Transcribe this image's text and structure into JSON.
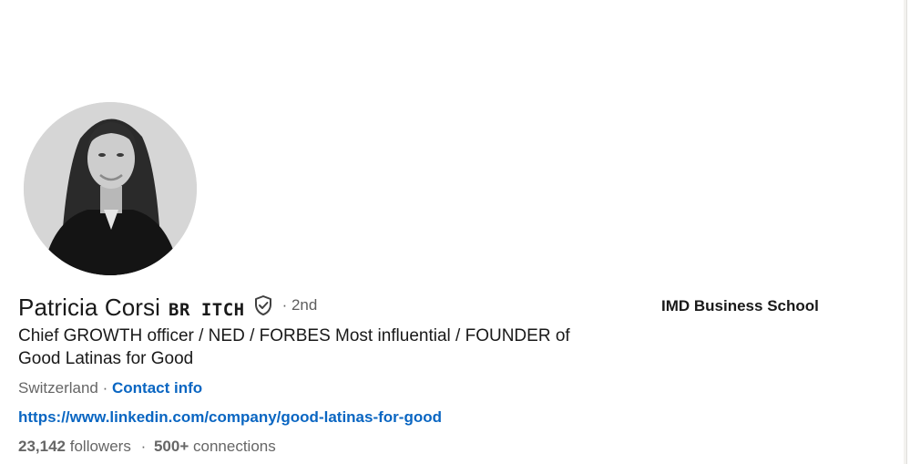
{
  "profile": {
    "name": "Patricia Corsi",
    "pronoun_badge": "BR ITCH",
    "verified_icon": "verified-shield-icon",
    "degree": "· 2nd",
    "headline": "Chief GROWTH officer / NED / FORBES Most influential / FOUNDER of Good Latinas for Good",
    "location": "Switzerland",
    "location_sep": " · ",
    "contact_info_label": "Contact info",
    "website": "https://www.linkedin.com/company/good-latinas-for-good",
    "followers_count": "23,142",
    "followers_label": "followers",
    "stats_sep": "·",
    "connections_count": "500+",
    "connections_label": "connections",
    "organization": "IMD Business School"
  },
  "colors": {
    "link": "#0a66c2",
    "text_primary": "#191919",
    "text_secondary": "#666666"
  }
}
